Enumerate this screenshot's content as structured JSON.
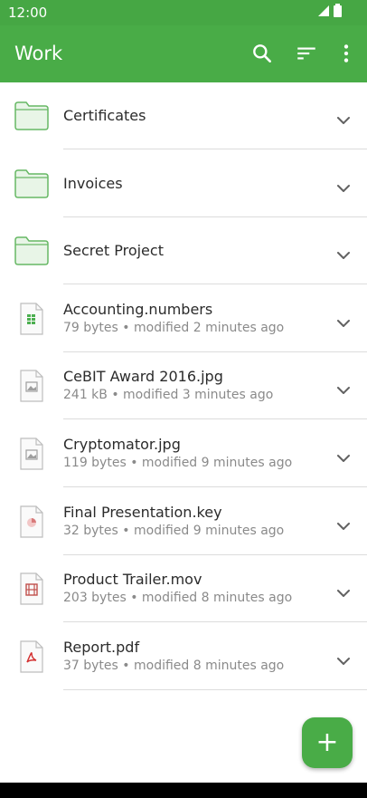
{
  "status": {
    "time": "12:00"
  },
  "appbar": {
    "title": "Work",
    "actions": [
      "search-icon",
      "sort-icon",
      "more-vert-icon"
    ]
  },
  "items": [
    {
      "kind": "folder",
      "name": "Certificates"
    },
    {
      "kind": "folder",
      "name": "Invoices"
    },
    {
      "kind": "folder",
      "name": "Secret Project"
    },
    {
      "kind": "file",
      "icon": "spreadsheet-file-icon",
      "name": "Accounting.numbers",
      "meta": "79 bytes • modified 2 minutes ago"
    },
    {
      "kind": "file",
      "icon": "image-file-icon",
      "name": "CeBIT Award 2016.jpg",
      "meta": "241 kB • modified 3 minutes ago"
    },
    {
      "kind": "file",
      "icon": "image-file-icon",
      "name": "Cryptomator.jpg",
      "meta": "119 bytes • modified 9 minutes ago"
    },
    {
      "kind": "file",
      "icon": "presentation-file-icon",
      "name": "Final Presentation.key",
      "meta": "32 bytes • modified 9 minutes ago"
    },
    {
      "kind": "file",
      "icon": "video-file-icon",
      "name": "Product Trailer.mov",
      "meta": "203 bytes • modified 8 minutes ago"
    },
    {
      "kind": "file",
      "icon": "pdf-file-icon",
      "name": "Report.pdf",
      "meta": "37 bytes • modified 8 minutes ago"
    }
  ],
  "fab": {
    "label": "+"
  },
  "colors": {
    "accent": "#49ac47",
    "statusbar": "#46a744",
    "folder_fill": "#e8f5e7",
    "folder_stroke": "#67b865"
  }
}
